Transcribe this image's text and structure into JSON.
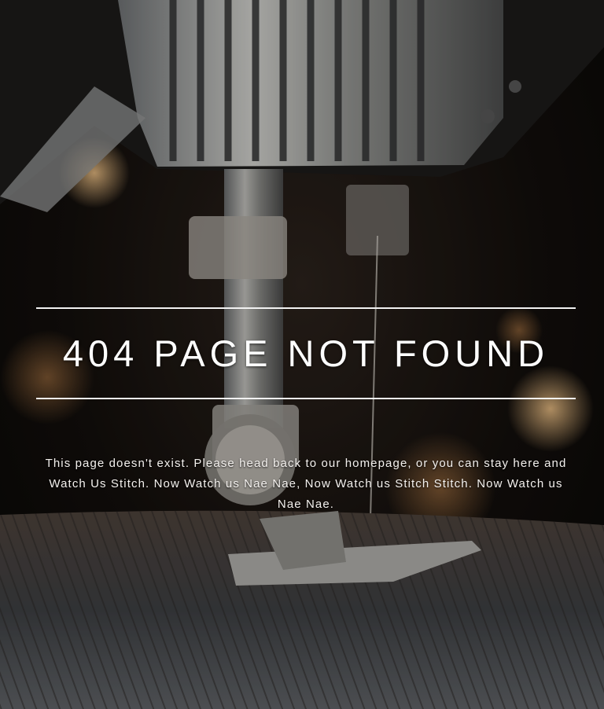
{
  "page": {
    "heading": "404 PAGE NOT FOUND",
    "message": "This page doesn't exist. Please head back to our homepage, or you can stay here and Watch Us Stitch. Now Watch us Nae Nae, Now Watch us Stitch Stitch. Now Watch us Nae Nae."
  },
  "background": {
    "subject": "sewing-machine-needle-on-denim"
  },
  "colors": {
    "text": "#ffffff",
    "rule": "#f2f2f2",
    "backdrop": "#120e0b"
  }
}
